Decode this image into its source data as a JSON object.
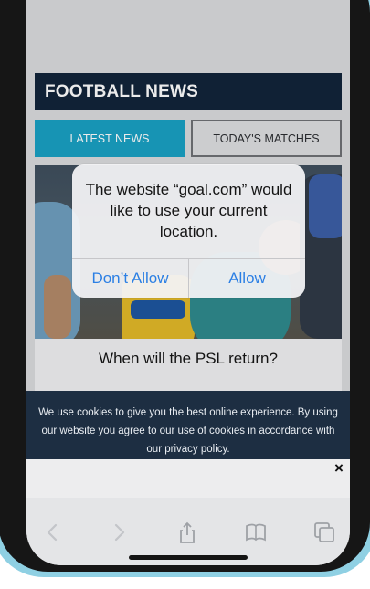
{
  "header": {
    "title": "FOOTBALL NEWS"
  },
  "tabs": [
    {
      "label": "LATEST NEWS",
      "active": true
    },
    {
      "label": "TODAY'S MATCHES",
      "active": false
    }
  ],
  "article": {
    "title": "When will the PSL return?"
  },
  "location_alert": {
    "message": "The website “goal.com” would like to use your current location.",
    "dont_allow_label": "Don’t Allow",
    "allow_label": "Allow"
  },
  "cookie_banner": {
    "text": "We use cookies to give you the best online experience. By using our website you agree to our use of cookies in accordance with our privacy policy.",
    "close_label": "×"
  },
  "toolbar": {
    "icons": [
      "back-icon",
      "forward-icon",
      "share-icon",
      "bookmarks-icon",
      "tabs-icon"
    ]
  },
  "colors": {
    "header_bg": "#12243a",
    "tab_active": "#1aa1c4",
    "alert_button": "#2b7fe4",
    "cookie_bg": "#1d2e42",
    "frame": "#8fd0e3"
  }
}
